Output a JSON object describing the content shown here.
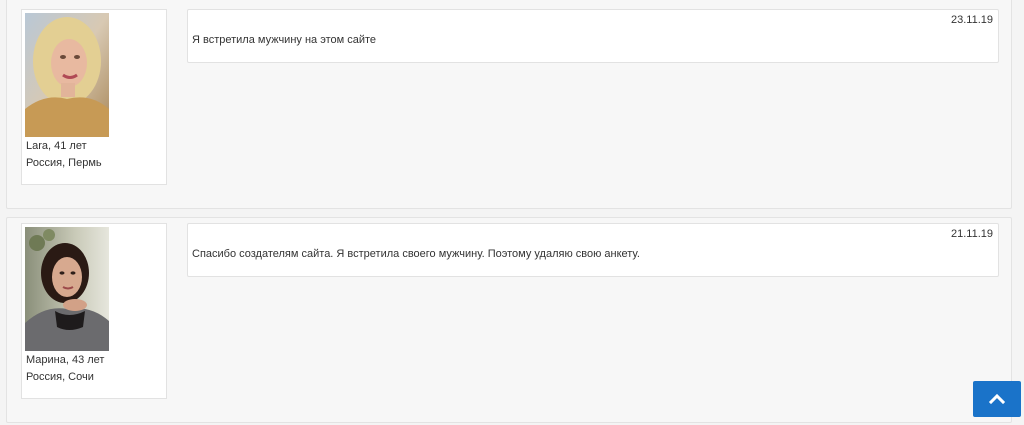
{
  "reviews": [
    {
      "name": "Lara, 41 лет",
      "location": "Россия, Пермь",
      "date": "23.11.19",
      "text": "Я встретила мужчину на этом сайте"
    },
    {
      "name": "Марина, 43 лет",
      "location": "Россия, Сочи",
      "date": "21.11.19",
      "text": "Спасибо создателям сайта. Я встретила своего мужчину. Поэтому удаляю свою анкету."
    }
  ],
  "scroll_top": {
    "icon": "chevron-up-icon",
    "color": "#1a73c9"
  }
}
